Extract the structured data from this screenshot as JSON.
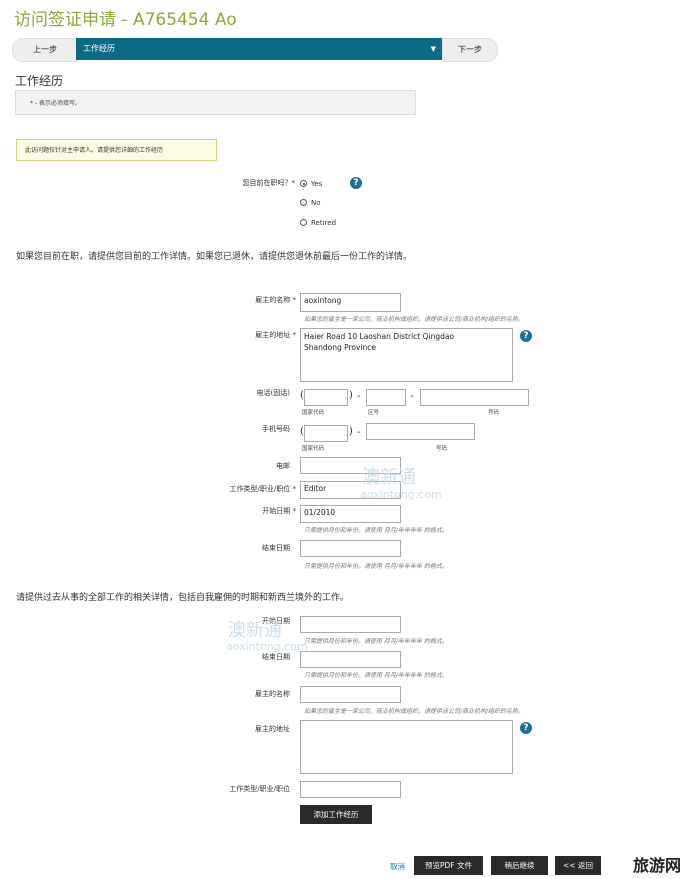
{
  "header": {
    "title": "访问签证申请 - A765454 Ao"
  },
  "nav": {
    "prev": "上一步",
    "current": "工作经历",
    "next": "下一步",
    "arrow": "▼"
  },
  "section": {
    "title": "工作经历",
    "required_note": "* - 表示必须填写。"
  },
  "notice": "此访问题仅针对主申请人。请提供您详细的工作经历",
  "employment": {
    "question": "您目前在职吗？*",
    "options": [
      "Yes",
      "No",
      "Retired"
    ],
    "selected": "Yes"
  },
  "current_job_intro": "如果您目前在职，请提供您目前的工作详情。如果您已退休，请提供您退休前最后一份工作的详情。",
  "current_job": {
    "employer_name_label": "雇主的名称 *",
    "employer_name_value": "aoxintong",
    "employer_name_hint": "如果您的雇主是一家公司、商业机构或组织，请提供该公司/商业机构/组织的名称。",
    "address_label": "雇主的地址 *",
    "address_line1": "Haier Road 10 Laoshan District Qingdao",
    "address_line2": "Shandong Province",
    "phone_label": "电话(固话)",
    "phone_sub": {
      "area": "国家代码",
      "region": "区号",
      "number": "号码"
    },
    "mobile_label": "手机号码",
    "mobile_sub": {
      "area": "国家代码",
      "number": "号码"
    },
    "email_label": "电邮",
    "job_label": "工作类型/职业/职位 *",
    "job_value": "Editor",
    "start_label": "开始日期 *",
    "start_value": "01/2010",
    "date_hint": "只需提供月份和年份。请使用 月月/年年年年 的格式。",
    "end_label": "结束日期"
  },
  "past_intro": "请提供过去从事的全部工作的相关详情，包括自我雇佣的时期和新西兰境外的工作。",
  "past_job": {
    "start_label": "开始日期",
    "end_label": "结束日期",
    "date_hint": "只需提供月份和年份。请使用 月月/年年年年 的格式。",
    "employer_name_label": "雇主的名称",
    "employer_name_hint": "如果您的雇主是一家公司、商业机构或组织，请提供该公司/商业机构/组织的名称。",
    "address_label": "雇主的地址",
    "job_label": "工作类型/职业/职位",
    "add_button": "添加工作经历"
  },
  "footer": {
    "cancel": "取消",
    "preview": "预览PDF 文件",
    "save": "稍后继续",
    "back": "<< 返回"
  },
  "watermark": {
    "text1": "澳新通",
    "text2": "aoxintong.com"
  },
  "corner_mark": "旅游网"
}
